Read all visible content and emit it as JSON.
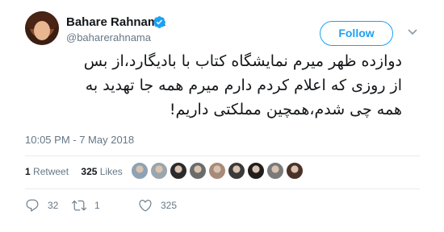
{
  "user": {
    "display_name": "Bahare Rahnama",
    "handle": "@baharerahnama",
    "verified": true
  },
  "follow_button": {
    "label": "Follow"
  },
  "tweet": {
    "text": "دوازده ظهر میرم نمایشگاه کتاب با بادیگارد،از بس\nاز روزی که اعلام کردم دارم میرم همه جا تهدید به\nهمه چی شدم،همچین مملکتی داریم!",
    "timestamp": "10:05 PM - 7 May 2018"
  },
  "stats": {
    "retweets_count": "1",
    "retweets_label": "Retweet",
    "likes_count": "325",
    "likes_label": "Likes"
  },
  "liker_avatars": [
    {
      "color": "#8fa2b4"
    },
    {
      "color": "#9aa5ad"
    },
    {
      "color": "#2b2b2b"
    },
    {
      "color": "#6b6b6b"
    },
    {
      "color": "#a88a78"
    },
    {
      "color": "#3a3a3a"
    },
    {
      "color": "#1f1f1f"
    },
    {
      "color": "#7a7a7a"
    },
    {
      "color": "#4a3228"
    }
  ],
  "actions": {
    "reply_count": "32",
    "retweet_count": "1",
    "like_count": "325"
  },
  "icons": {
    "verified": "verified-badge-icon",
    "menu": "chevron-down-icon",
    "reply": "reply-icon",
    "retweet": "retweet-icon",
    "like": "heart-icon"
  },
  "colors": {
    "accent": "#1da1f2",
    "secondary_text": "#657786",
    "primary_text": "#14171a",
    "divider": "#e6ecf0"
  }
}
